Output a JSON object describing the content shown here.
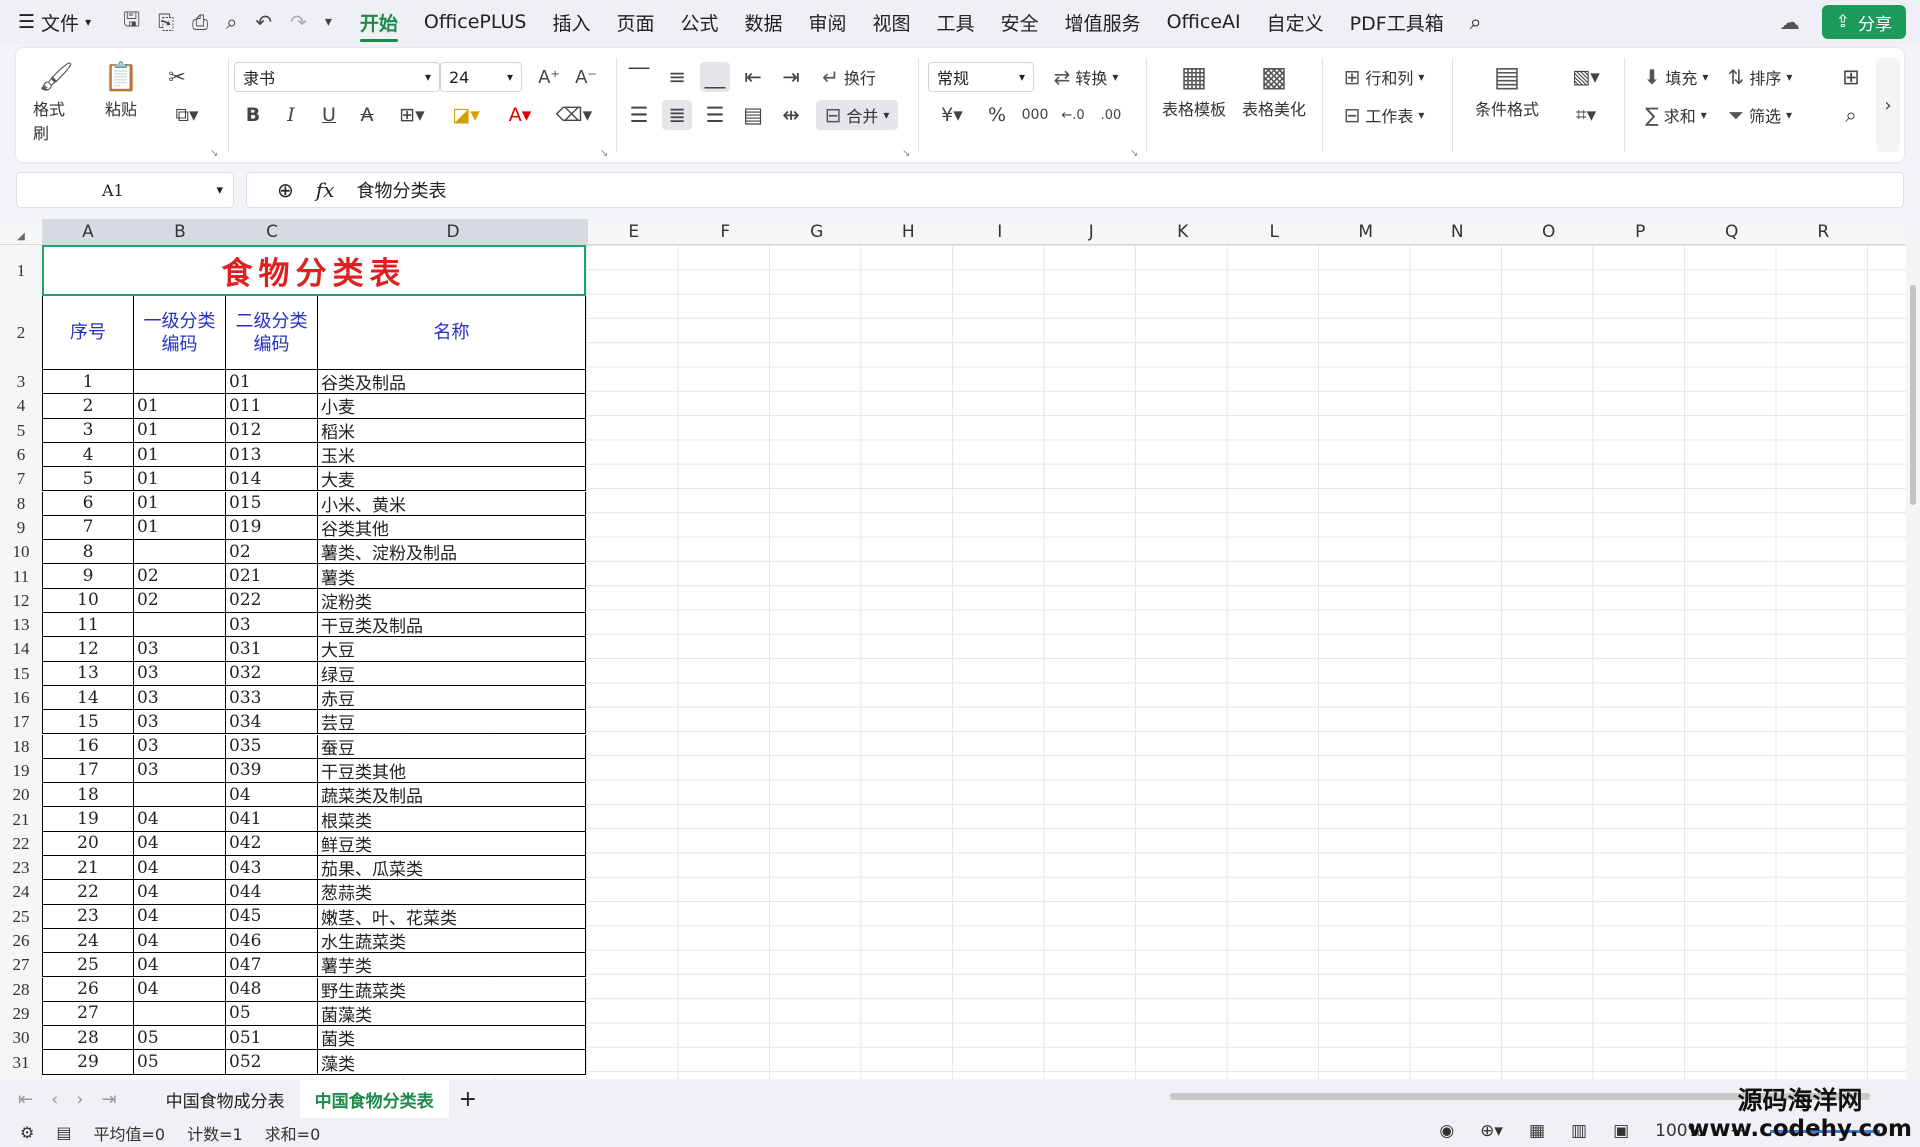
{
  "menubar": {
    "file": "文件",
    "tabs": [
      "开始",
      "OfficePLUS",
      "插入",
      "页面",
      "公式",
      "数据",
      "审阅",
      "视图",
      "工具",
      "安全",
      "增值服务",
      "OfficeAI",
      "自定义",
      "PDF工具箱"
    ],
    "active_tab": "开始",
    "share": "分享"
  },
  "ribbon": {
    "format_painter": "格式刷",
    "paste": "粘贴",
    "font_name": "隶书",
    "font_size": "24",
    "wrap": "换行",
    "merge": "合并",
    "number_format": "常规",
    "convert": "转换",
    "table_template": "表格模板",
    "table_beautify": "表格美化",
    "rows_cols": "行和列",
    "worksheet": "工作表",
    "conditional_format": "条件格式",
    "fill": "填充",
    "sort": "排序",
    "sum": "求和",
    "filter": "筛选"
  },
  "formula_bar": {
    "cell_ref": "A1",
    "fx": "fx",
    "value": "食物分类表"
  },
  "columns": [
    "A",
    "B",
    "C",
    "D",
    "E",
    "F",
    "G",
    "H",
    "I",
    "J",
    "K",
    "L",
    "M",
    "N",
    "O",
    "P",
    "Q",
    "R"
  ],
  "rows": [
    "1",
    "2",
    "3",
    "4",
    "5",
    "6",
    "7",
    "8",
    "9",
    "10",
    "11",
    "12",
    "13",
    "14",
    "15",
    "16",
    "17",
    "18",
    "19",
    "20",
    "21",
    "22",
    "23",
    "24",
    "25",
    "26",
    "27",
    "28",
    "29",
    "30",
    "31"
  ],
  "table": {
    "title": "食物分类表",
    "headers": [
      "序号",
      "一级分类\n编码",
      "二级分类\n编码",
      "名称"
    ],
    "rows": [
      [
        "1",
        "",
        "01",
        "谷类及制品"
      ],
      [
        "2",
        "01",
        "011",
        "小麦"
      ],
      [
        "3",
        "01",
        "012",
        "稻米"
      ],
      [
        "4",
        "01",
        "013",
        "玉米"
      ],
      [
        "5",
        "01",
        "014",
        "大麦"
      ],
      [
        "6",
        "01",
        "015",
        "小米、黄米"
      ],
      [
        "7",
        "01",
        "019",
        "谷类其他"
      ],
      [
        "8",
        "",
        "02",
        "薯类、淀粉及制品"
      ],
      [
        "9",
        "02",
        "021",
        "薯类"
      ],
      [
        "10",
        "02",
        "022",
        "淀粉类"
      ],
      [
        "11",
        "",
        "03",
        "干豆类及制品"
      ],
      [
        "12",
        "03",
        "031",
        "大豆"
      ],
      [
        "13",
        "03",
        "032",
        "绿豆"
      ],
      [
        "14",
        "03",
        "033",
        "赤豆"
      ],
      [
        "15",
        "03",
        "034",
        "芸豆"
      ],
      [
        "16",
        "03",
        "035",
        "蚕豆"
      ],
      [
        "17",
        "03",
        "039",
        "干豆类其他"
      ],
      [
        "18",
        "",
        "04",
        "蔬菜类及制品"
      ],
      [
        "19",
        "04",
        "041",
        "根菜类"
      ],
      [
        "20",
        "04",
        "042",
        "鲜豆类"
      ],
      [
        "21",
        "04",
        "043",
        "茄果、瓜菜类"
      ],
      [
        "22",
        "04",
        "044",
        "葱蒜类"
      ],
      [
        "23",
        "04",
        "045",
        "嫩茎、叶、花菜类"
      ],
      [
        "24",
        "04",
        "046",
        "水生蔬菜类"
      ],
      [
        "25",
        "04",
        "047",
        "薯芋类"
      ],
      [
        "26",
        "04",
        "048",
        "野生蔬菜类"
      ],
      [
        "27",
        "",
        "05",
        "菌藻类"
      ],
      [
        "28",
        "05",
        "051",
        "菌类"
      ],
      [
        "29",
        "05",
        "052",
        "藻类"
      ]
    ]
  },
  "sheets": [
    "中国食物成分表",
    "中国食物分类表"
  ],
  "active_sheet": "中国食物分类表",
  "status": {
    "average": "平均值=0",
    "count": "计数=1",
    "sum": "求和=0",
    "zoom": "100%"
  },
  "watermark": {
    "line1": "源码海洋网",
    "line2": "www.codehy.com"
  },
  "colors": {
    "accent": "#1d8a4c",
    "title": "#e02020",
    "header_text": "#2431c6"
  }
}
